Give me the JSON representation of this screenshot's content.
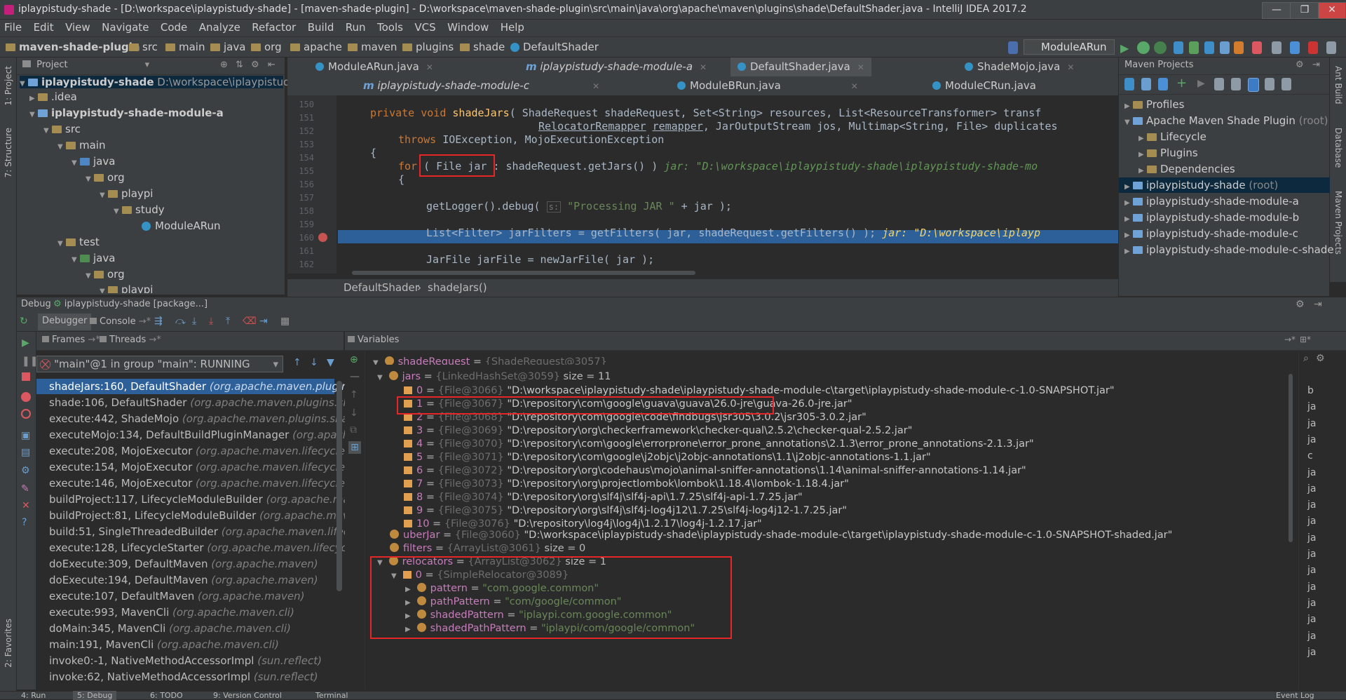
{
  "window": {
    "title": "iplaypistudy-shade - [D:\\workspace\\iplaypistudy-shade] - [maven-shade-plugin] - D:\\workspace\\maven-shade-plugin\\src\\main\\java\\org\\apache\\maven\\plugins\\shade\\DefaultShader.java - IntelliJ IDEA 2017.2"
  },
  "menu": [
    "File",
    "Edit",
    "View",
    "Navigate",
    "Code",
    "Analyze",
    "Refactor",
    "Build",
    "Run",
    "Tools",
    "VCS",
    "Window",
    "Help"
  ],
  "breadcrumb": [
    "maven-shade-plugin",
    "src",
    "main",
    "java",
    "org",
    "apache",
    "maven",
    "plugins",
    "shade",
    "DefaultShader"
  ],
  "run_config": "ModuleARun",
  "project": {
    "header": "Project",
    "root": "iplaypistudy-shade",
    "root_path": "D:\\workspace\\iplaypistudy-sha",
    "items": [
      ".idea",
      "iplaypistudy-shade-module-a",
      "src",
      "main",
      "java",
      "org",
      "playpi",
      "study",
      "ModuleARun",
      "test",
      "java",
      "org",
      "playpi"
    ]
  },
  "editor": {
    "tabs_row1": [
      "ModuleARun.java",
      "iplaypistudy-shade-module-a",
      "DefaultShader.java",
      "ShadeMojo.java"
    ],
    "tabs_row2": [
      "iplaypistudy-shade-module-c",
      "ModuleBRun.java",
      "ModuleCRun.java"
    ],
    "line_numbers": [
      "150",
      "151",
      "152",
      "153",
      "154",
      "155",
      "156",
      "157",
      "158",
      "159",
      "160",
      "161",
      "162",
      "163"
    ],
    "breadcrumb": [
      "DefaultShader",
      "shadeJars()"
    ]
  },
  "maven": {
    "header": "Maven Projects",
    "items": [
      "Profiles",
      "Apache Maven Shade Plugin",
      "(root)",
      "Lifecycle",
      "Plugins",
      "Dependencies",
      "iplaypistudy-shade",
      "(root)",
      "iplaypistudy-shade-module-a",
      "iplaypistudy-shade-module-b",
      "iplaypistudy-shade-module-c",
      "iplaypistudy-shade-module-c-shade"
    ]
  },
  "debug": {
    "title": "Debug",
    "config": "iplaypistudy-shade [package...]",
    "tabs": [
      "Debugger",
      "Console"
    ],
    "subtabs": [
      "Frames",
      "Threads"
    ],
    "thread": "\"main\"@1 in group \"main\": RUNNING",
    "frames": [
      {
        "m": "shadeJars:160, DefaultShader",
        "p": "(org.apache.maven.plugins.shad"
      },
      {
        "m": "shade:106, DefaultShader",
        "p": "(org.apache.maven.plugins.shade)"
      },
      {
        "m": "execute:442, ShadeMojo",
        "p": "(org.apache.maven.plugins.shade.mo"
      },
      {
        "m": "executeMojo:134, DefaultBuildPluginManager",
        "p": "(org.apache.ma"
      },
      {
        "m": "execute:208, MojoExecutor",
        "p": "(org.apache.maven.lifecycle.intern"
      },
      {
        "m": "execute:154, MojoExecutor",
        "p": "(org.apache.maven.lifecycle.intern"
      },
      {
        "m": "execute:146, MojoExecutor",
        "p": "(org.apache.maven.lifecycle.intern"
      },
      {
        "m": "buildProject:117, LifecycleModuleBuilder",
        "p": "(org.apache.maven.li"
      },
      {
        "m": "buildProject:81, LifecycleModuleBuilder",
        "p": "(org.apache.maven.lif"
      },
      {
        "m": "build:51, SingleThreadedBuilder",
        "p": "(org.apache.maven.lifecycle.ir"
      },
      {
        "m": "execute:128, LifecycleStarter",
        "p": "(org.apache.maven.lifecycle.interr"
      },
      {
        "m": "doExecute:309, DefaultMaven",
        "p": "(org.apache.maven)"
      },
      {
        "m": "doExecute:194, DefaultMaven",
        "p": "(org.apache.maven)"
      },
      {
        "m": "execute:107, DefaultMaven",
        "p": "(org.apache.maven)"
      },
      {
        "m": "execute:993, MavenCli",
        "p": "(org.apache.maven.cli)"
      },
      {
        "m": "doMain:345, MavenCli",
        "p": "(org.apache.maven.cli)"
      },
      {
        "m": "main:191, MavenCli",
        "p": "(org.apache.maven.cli)"
      },
      {
        "m": "invoke0:-1, NativeMethodAccessorImpl",
        "p": "(sun.reflect)"
      },
      {
        "m": "invoke:62, NativeMethodAccessorImpl",
        "p": "(sun.reflect)"
      }
    ],
    "variables_header": "Variables",
    "jars_entries": [
      {
        "i": "0",
        "ref": "{File@3066}",
        "path": "\"D:\\workspace\\iplaypistudy-shade\\iplaypistudy-shade-module-c\\target\\iplaypistudy-shade-module-c-1.0-SNAPSHOT.jar\""
      },
      {
        "i": "1",
        "ref": "{File@3067}",
        "path": "\"D:\\repository\\com\\google\\guava\\guava\\26.0-jre\\guava-26.0-jre.jar\""
      },
      {
        "i": "2",
        "ref": "{File@3068}",
        "path": "\"D:\\repository\\com\\google\\code\\findbugs\\jsr305\\3.0.2\\jsr305-3.0.2.jar\""
      },
      {
        "i": "3",
        "ref": "{File@3069}",
        "path": "\"D:\\repository\\org\\checkerframework\\checker-qual\\2.5.2\\checker-qual-2.5.2.jar\""
      },
      {
        "i": "4",
        "ref": "{File@3070}",
        "path": "\"D:\\repository\\com\\google\\errorprone\\error_prone_annotations\\2.1.3\\error_prone_annotations-2.1.3.jar\""
      },
      {
        "i": "5",
        "ref": "{File@3071}",
        "path": "\"D:\\repository\\com\\google\\j2objc\\j2objc-annotations\\1.1\\j2objc-annotations-1.1.jar\""
      },
      {
        "i": "6",
        "ref": "{File@3072}",
        "path": "\"D:\\repository\\org\\codehaus\\mojo\\animal-sniffer-annotations\\1.14\\animal-sniffer-annotations-1.14.jar\""
      },
      {
        "i": "7",
        "ref": "{File@3073}",
        "path": "\"D:\\repository\\org\\projectlombok\\lombok\\1.18.4\\lombok-1.18.4.jar\""
      },
      {
        "i": "8",
        "ref": "{File@3074}",
        "path": "\"D:\\repository\\org\\slf4j\\slf4j-api\\1.7.25\\slf4j-api-1.7.25.jar\""
      },
      {
        "i": "9",
        "ref": "{File@3075}",
        "path": "\"D:\\repository\\org\\slf4j\\slf4j-log4j12\\1.7.25\\slf4j-log4j12-1.7.25.jar\""
      },
      {
        "i": "10",
        "ref": "{File@3076}",
        "path": "\"D:\\repository\\log4j\\log4j\\1.2.17\\log4j-1.2.17.jar\""
      }
    ],
    "uberjar_path": "\"D:\\workspace\\iplaypistudy-shade\\iplaypistudy-shade-module-c\\target\\iplaypistudy-shade-module-c-1.0-SNAPSHOT-shaded.jar\"",
    "right_column": [
      "b",
      "ja",
      "ja",
      "ja",
      "c",
      "ja",
      "ja",
      "ja",
      "ja",
      "ja",
      "ja",
      "ja",
      "ja",
      "ja",
      "ja",
      "ja",
      "ja"
    ]
  },
  "statusbar": [
    "4: Run",
    "5: Debug",
    "6: TODO",
    "9: Version Control",
    "Terminal",
    "Event Log"
  ],
  "colors": {
    "accent": "#2f65ca",
    "highlight_red": "#e52727",
    "bg": "#2b2b2b",
    "panel": "#3c3f41"
  }
}
